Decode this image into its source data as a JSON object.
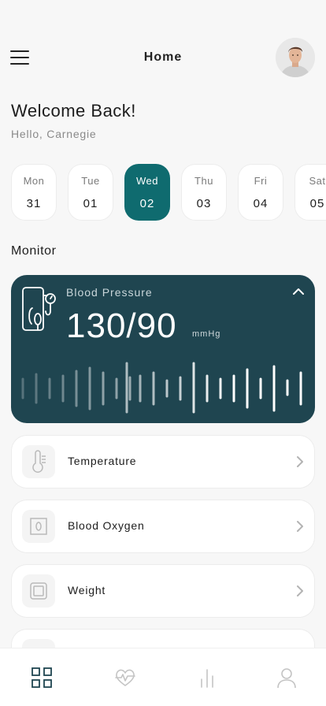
{
  "header": {
    "title": "Home"
  },
  "greeting": {
    "welcome": "Welcome Back!",
    "hello": "Hello, Carnegie"
  },
  "days": [
    {
      "name": "Mon",
      "num": "31"
    },
    {
      "name": "Tue",
      "num": "01"
    },
    {
      "name": "Wed",
      "num": "02",
      "active": true
    },
    {
      "name": "Thu",
      "num": "03"
    },
    {
      "name": "Fri",
      "num": "04"
    },
    {
      "name": "Sat",
      "num": "05"
    }
  ],
  "monitor": {
    "title": "Monitor",
    "blood_pressure": {
      "label": "Blood Pressure",
      "value": "130/90",
      "unit": "mmHg"
    },
    "items": [
      {
        "label": "Temperature",
        "icon": "thermometer-icon"
      },
      {
        "label": "Blood Oxygen",
        "icon": "oxygen-icon"
      },
      {
        "label": "Weight",
        "icon": "scale-icon"
      }
    ]
  },
  "nav": [
    "grid-icon",
    "heart-pulse-icon",
    "bar-chart-icon",
    "user-icon"
  ],
  "colors": {
    "accent": "#0f6b6f",
    "card": "#1f4550",
    "background": "#f7f7f7"
  }
}
